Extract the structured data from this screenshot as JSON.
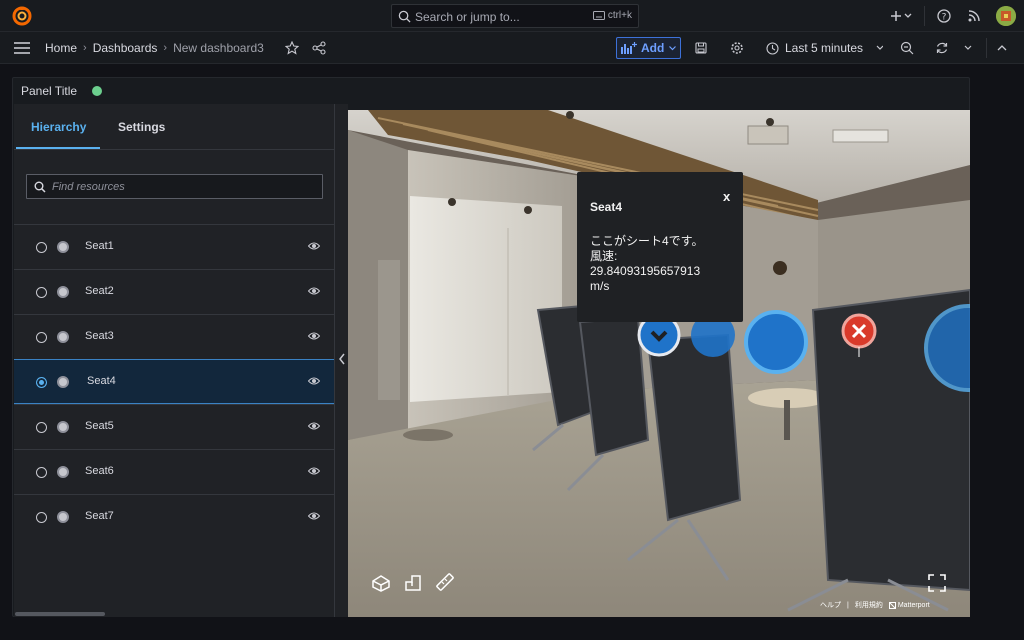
{
  "topbar": {
    "search_placeholder": "Search or jump to...",
    "shortcut": "ctrl+k"
  },
  "breadcrumb": {
    "items": [
      "Home",
      "Dashboards",
      "New dashboard3"
    ]
  },
  "toolbar": {
    "add_label": "Add",
    "time_range": "Last 5 minutes"
  },
  "panel": {
    "title": "Panel Title",
    "status_color": "#6ccf8e"
  },
  "sidebar": {
    "tabs": [
      "Hierarchy",
      "Settings"
    ],
    "find_placeholder": "Find resources",
    "items": [
      {
        "label": "Seat1",
        "selected": false
      },
      {
        "label": "Seat2",
        "selected": false
      },
      {
        "label": "Seat3",
        "selected": false
      },
      {
        "label": "Seat4",
        "selected": true
      },
      {
        "label": "Seat5",
        "selected": false
      },
      {
        "label": "Seat6",
        "selected": false
      },
      {
        "label": "Seat7",
        "selected": false
      }
    ]
  },
  "tooltip": {
    "title": "Seat4",
    "close": "x",
    "body": "ここがシート4です。\n風速:\n29.84093195657913\nm/s"
  },
  "viewer_footer": {
    "help": "ヘルプ",
    "separator": "|",
    "terms": "利用規約",
    "brand": "Matterport"
  },
  "colors": {
    "accent": "#5ab1ef",
    "add_button": "#3d71d9",
    "marker_blue": "#1f73c9",
    "marker_red": "#d93a2b"
  }
}
